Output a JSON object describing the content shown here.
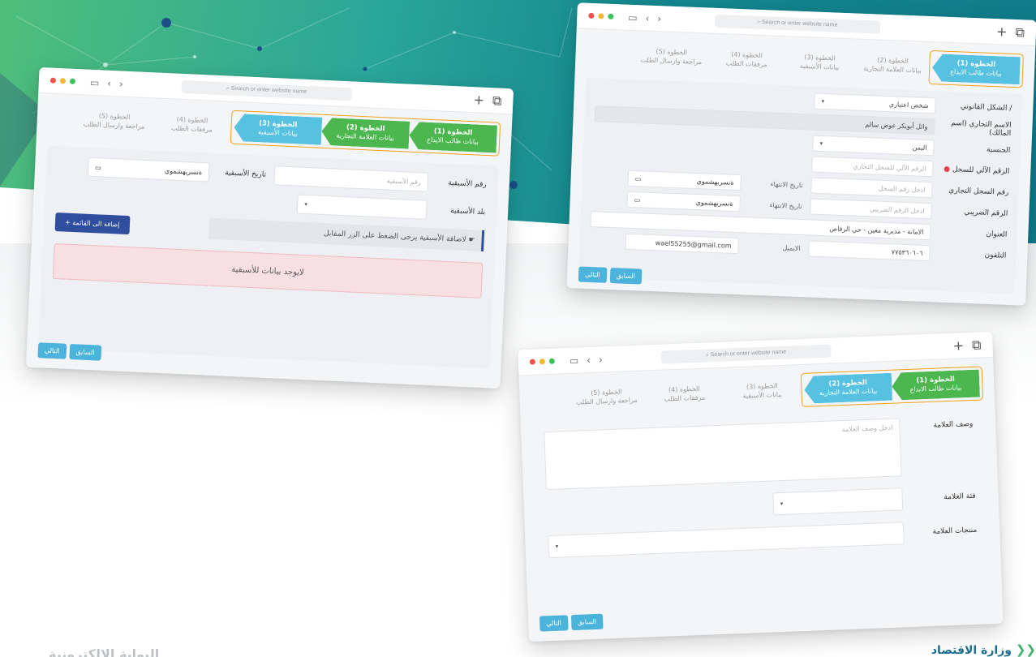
{
  "browser": {
    "address_placeholder": "Search or enter website name",
    "plus_glyph": "+",
    "copy_glyph": "⧉",
    "sidebar_glyph": "▭",
    "back_glyph": "‹",
    "forward_glyph": "›"
  },
  "steps": [
    {
      "num": "الخطوة (1)",
      "label": "بيانات طالب الايداع"
    },
    {
      "num": "الخطوة (2)",
      "label": "بيانات العلامة التجارية"
    },
    {
      "num": "الخطوة (3)",
      "label": "بيانات الأسبقية"
    },
    {
      "num": "الخطوة (4)",
      "label": "مرفقات الطلب"
    },
    {
      "num": "الخطوة (5)",
      "label": "مراجعة وارسال الطلب"
    }
  ],
  "nav": {
    "prev": "السابق",
    "next": "التالي"
  },
  "priority_form": {
    "number_label": "رقم الأسبقية",
    "number_placeholder": "رقم الأسبقية",
    "date_label": "تاريخ الأسبقية",
    "date_value": "ةنسريهشموي",
    "country_label": "بلد الأسبقية",
    "hint": "لاضافة الأسبقية يرجى الضغط على الزر المقابل ☛",
    "add_button": "+  إضافة الى القائمة",
    "empty_alert": "لايوجد بيانات للأسبقية"
  },
  "applicant_form": {
    "legal_form_label": "الشكل القانوني /",
    "legal_form_value": "شخص اعتباري",
    "trade_name_label": "الاسم التجاري (اسم المالك)",
    "trade_name_value": "وائل أبوبكر عوض سالم",
    "nationality_label": "الجنسية",
    "nationality_value": "اليمن",
    "auto_reg_label": "الرقم الآلي للسجل",
    "auto_reg_placeholder": "الرقم الآلي للسجل التجاري",
    "cr_label": "رقم السجل التجاري",
    "cr_placeholder": "ادخل رقم السجل",
    "cr_expiry_label": "تاريخ الانتهاء",
    "cr_expiry_value": "ةنسريهشموي",
    "tax_label": "الرقم الضريبي",
    "tax_placeholder": "ادخل الرقم الضريبي",
    "tax_expiry_label": "تاريخ الانتهاء",
    "tax_expiry_value": "ةنسريهشموي",
    "address_label": "العنوان",
    "address_value": "الامانة - مديرية معين - حي الرقاص",
    "email_label": "الايميل",
    "email_value": "wael55255@gmail.com",
    "phone_label": "التلفون",
    "phone_value": "٧٧٥٣٦٠٦٠٦"
  },
  "mark_form": {
    "desc_label": "وصف العلامة",
    "desc_placeholder": "ادخل وصف العلامة",
    "class_label": "فئة العلامة",
    "products_label": "منتجات العلامة"
  },
  "brand": {
    "name": "وزارة الاقتصاد",
    "footer_text": "البوابة الإلكترونية"
  }
}
